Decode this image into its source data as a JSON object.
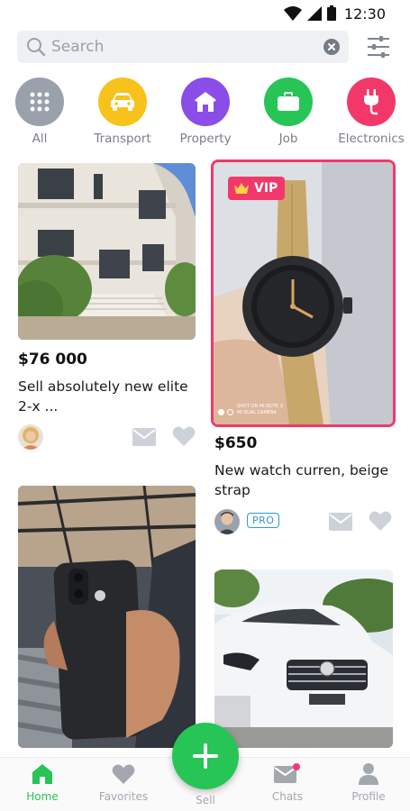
{
  "status_bar": {
    "time": "12:30",
    "icons": [
      "wifi-icon",
      "signal-icon",
      "battery-icon"
    ]
  },
  "search": {
    "placeholder": "Search",
    "value": ""
  },
  "categories": [
    {
      "label": "All",
      "icon": "grid-icon",
      "color": "#9aa1ad"
    },
    {
      "label": "Transport",
      "icon": "car-icon",
      "color": "#f7c21c"
    },
    {
      "label": "Property",
      "icon": "house-icon",
      "color": "#8a4de8"
    },
    {
      "label": "Job",
      "icon": "briefcase-icon",
      "color": "#27c556"
    },
    {
      "label": "Electronics",
      "icon": "plug-icon",
      "color": "#f2386a"
    }
  ],
  "listings": [
    {
      "price": "$76 000",
      "title": "Sell absolutely new elite 2-x ...",
      "image": "villa-photo"
    },
    {
      "price": "$650",
      "title": "New watch curren, beige strap",
      "badge": "VIP",
      "seller_badge": "PRO",
      "image": "watch-photo"
    },
    {
      "image": "iphone-photo"
    },
    {
      "image": "mercedes-car-photo"
    }
  ],
  "watch_photo_caption": [
    "SHOT ON MI NOTE 3",
    "MI DUAL CAMERA"
  ],
  "nav": {
    "home": "Home",
    "favorites": "Favorites",
    "sell": "Sell",
    "chats": "Chats",
    "profile": "Profile"
  },
  "colors": {
    "accent": "#27c556",
    "vip": "#f2386a",
    "pro": "#2b9bd6",
    "muted": "#a2a7b0"
  }
}
